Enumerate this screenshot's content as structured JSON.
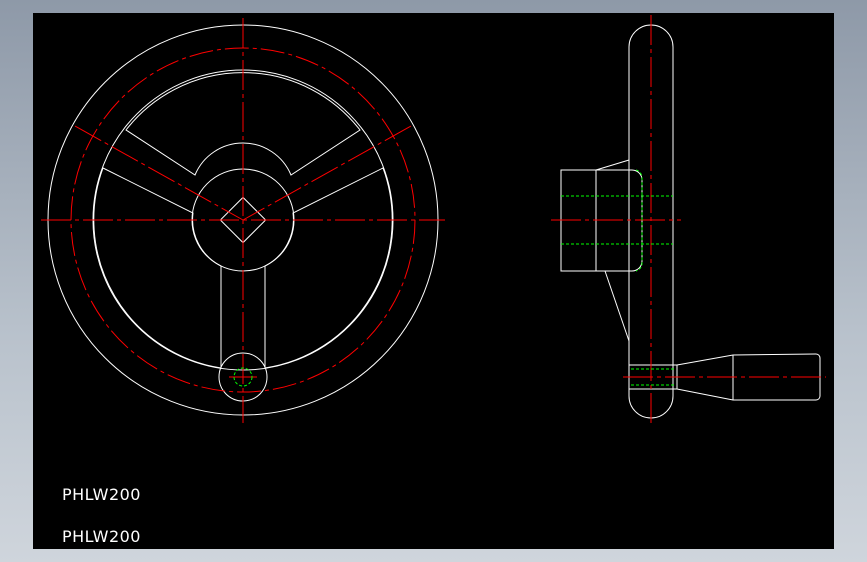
{
  "drawing": {
    "labels": [
      "PHLW200",
      "PHLW200"
    ]
  },
  "colors": {
    "background": "#000000",
    "outline": "#ffffff",
    "centerline": "#ff0000",
    "hidden": "#00ff00"
  }
}
